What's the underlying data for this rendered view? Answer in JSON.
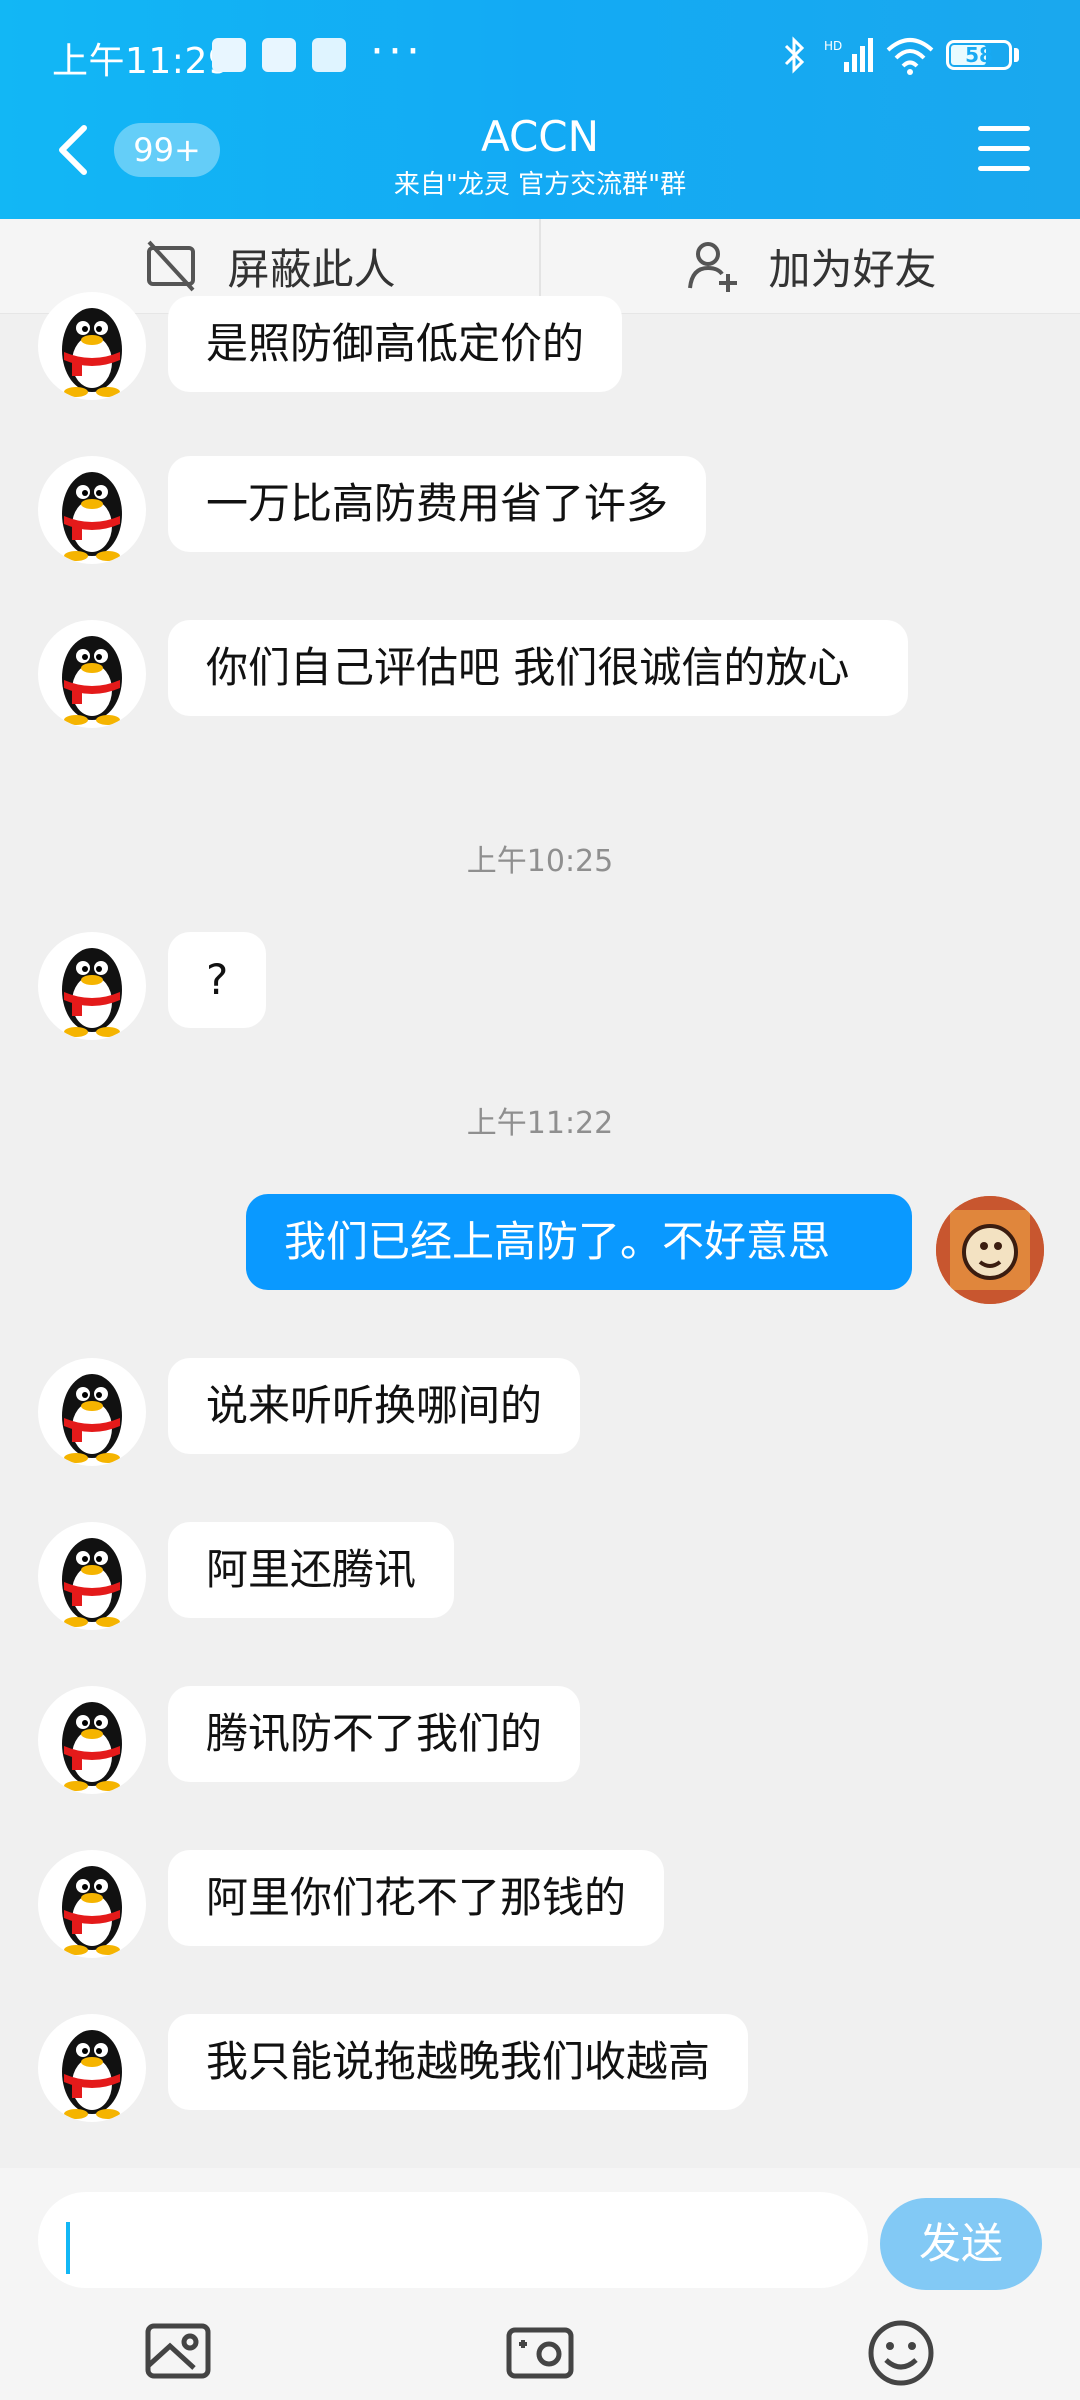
{
  "status_bar": {
    "time": "上午11:29",
    "battery": "58",
    "network_label": "HD"
  },
  "header": {
    "back_badge": "99+",
    "title": "ACCN",
    "subtitle": "来自\"龙灵 官方交流群\"群"
  },
  "actions": {
    "block": "屏蔽此人",
    "add_friend": "加为好友"
  },
  "messages": [
    {
      "text": "是照防御高低定价的"
    },
    {
      "text": "一万比高防费用省了许多"
    },
    {
      "text": "你们自己评估吧 我们很诚信的放心"
    },
    {
      "text": "?"
    },
    {
      "text": "我们已经上高防了。不好意思"
    },
    {
      "text": "说来听听换哪间的"
    },
    {
      "text": "阿里还腾讯"
    },
    {
      "text": "腾讯防不了我们的"
    },
    {
      "text": "阿里你们花不了那钱的"
    },
    {
      "text": "我只能说拖越晚我们收越高"
    }
  ],
  "timestamps": [
    "上午10:25",
    "上午11:22"
  ],
  "input": {
    "value": "",
    "send_label": "发送"
  },
  "colors": {
    "header": "#12b7f5",
    "my_bubble": "#0a99ff",
    "send_button": "#82c9f5"
  }
}
